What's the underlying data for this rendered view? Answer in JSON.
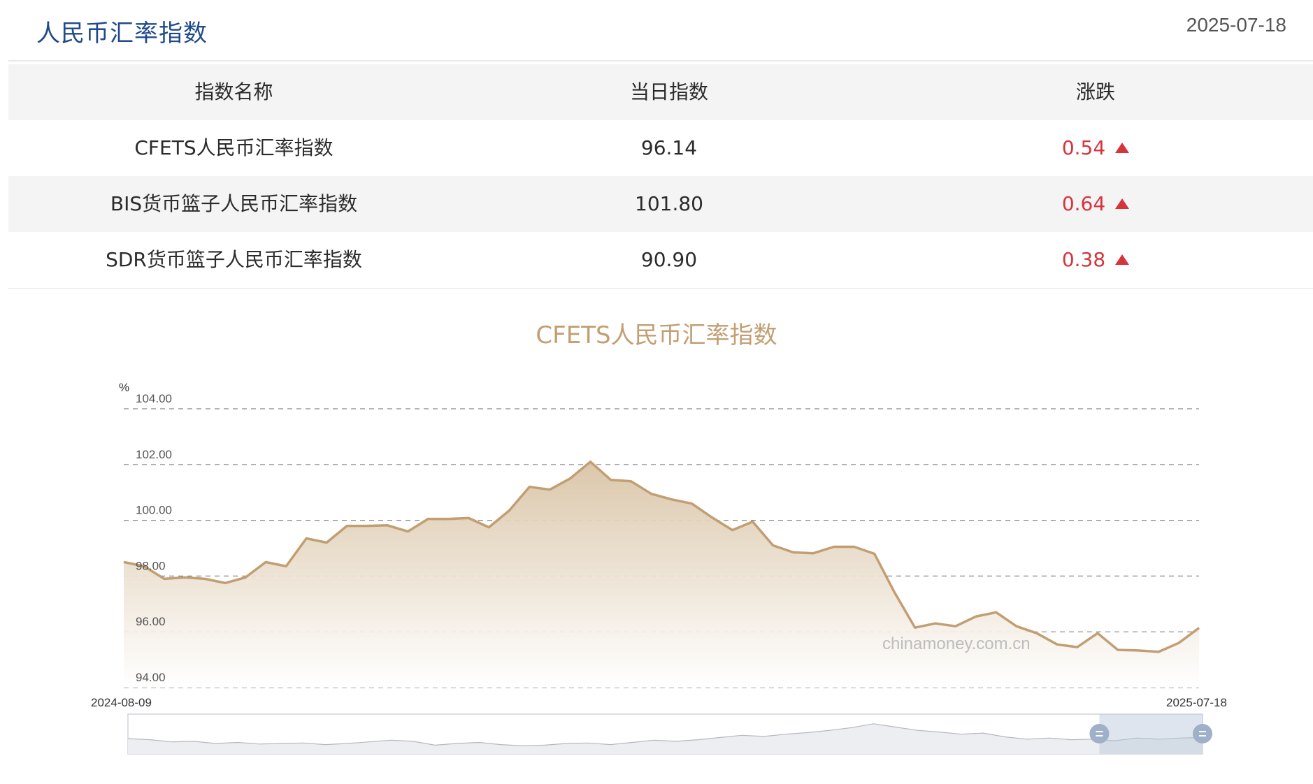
{
  "header": {
    "title": "人民币汇率指数",
    "date": "2025-07-18"
  },
  "table": {
    "columns": [
      "指数名称",
      "当日指数",
      "涨跌"
    ],
    "rows": [
      {
        "name": "CFETS人民币汇率指数",
        "value": "96.14",
        "change": "0.54",
        "direction": "up"
      },
      {
        "name": "BIS货币篮子人民币汇率指数",
        "value": "101.80",
        "change": "0.64",
        "direction": "up"
      },
      {
        "name": "SDR货币篮子人民币汇率指数",
        "value": "90.90",
        "change": "0.38",
        "direction": "up"
      }
    ]
  },
  "colors": {
    "title": "#1f4a8a",
    "up": "#d6343c",
    "chart_line": "#c29e72",
    "chart_fill_top": "#d9c4a6",
    "chart_fill_bottom": "#ffffff"
  },
  "chart_data": {
    "type": "area",
    "title": "CFETS人民币汇率指数",
    "ylabel": "%",
    "ylim": [
      94,
      104
    ],
    "yticks": [
      "94.00",
      "96.00",
      "98.00",
      "100.00",
      "102.00",
      "104.00"
    ],
    "x_start": "2024-08-09",
    "x_end": "2025-07-18",
    "grid": true,
    "watermark": "chinamoney.com.cn",
    "values": [
      98.5,
      98.35,
      97.9,
      97.95,
      97.9,
      97.75,
      97.95,
      98.5,
      98.35,
      99.35,
      99.2,
      99.8,
      99.8,
      99.82,
      99.6,
      100.05,
      100.05,
      100.08,
      99.75,
      100.35,
      101.2,
      101.1,
      101.5,
      102.1,
      101.45,
      101.4,
      100.95,
      100.75,
      100.6,
      100.1,
      99.65,
      99.95,
      99.1,
      98.85,
      98.82,
      99.05,
      99.05,
      98.8,
      97.4,
      96.15,
      96.3,
      96.2,
      96.55,
      96.7,
      96.2,
      95.95,
      95.55,
      95.45,
      95.95,
      95.35,
      95.33,
      95.28,
      95.6,
      96.14
    ],
    "overview": {
      "window_start": 0.904,
      "window_end": 1.0,
      "values": [
        98.8,
        98.6,
        98.2,
        98.3,
        97.9,
        98.1,
        97.8,
        97.9,
        98.0,
        97.7,
        97.9,
        98.2,
        98.5,
        98.3,
        97.6,
        97.9,
        98.1,
        97.7,
        97.5,
        97.6,
        97.9,
        98.0,
        97.7,
        98.1,
        98.5,
        98.3,
        98.6,
        99.0,
        99.4,
        99.2,
        99.6,
        99.9,
        100.3,
        100.8,
        101.5,
        100.9,
        100.3,
        100.0,
        99.6,
        99.8,
        99.1,
        98.7,
        98.9,
        98.6,
        98.7,
        98.4,
        98.9,
        98.7,
        98.9,
        99.0
      ]
    }
  }
}
